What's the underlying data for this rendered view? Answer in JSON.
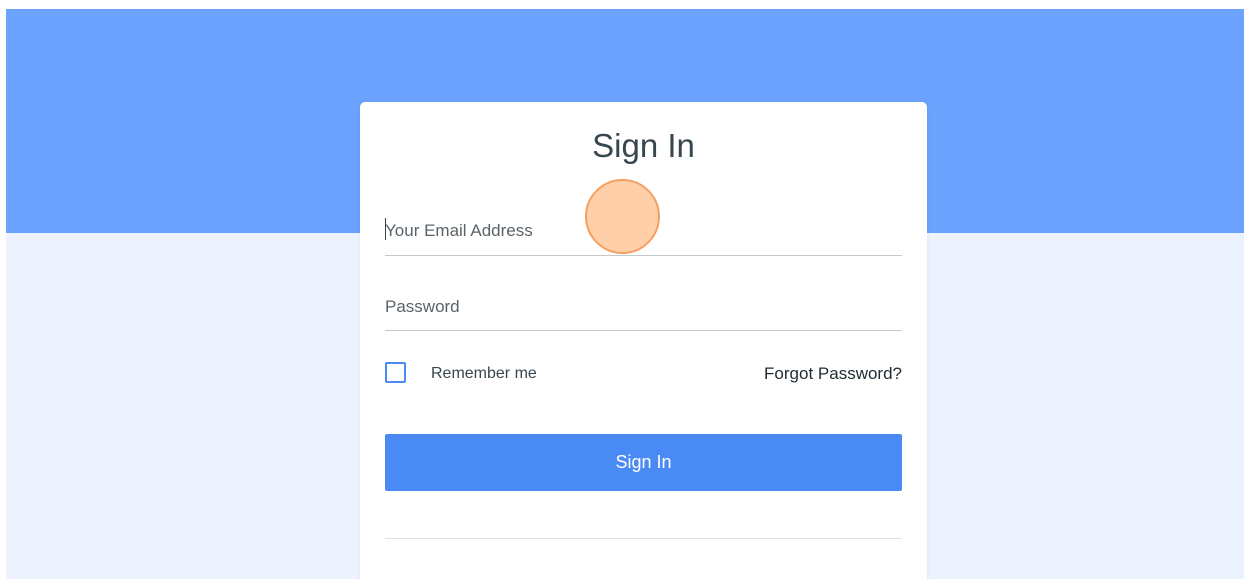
{
  "form": {
    "title": "Sign In",
    "email_placeholder": "Your Email Address",
    "email_value": "",
    "password_placeholder": "Password",
    "password_value": "",
    "remember_label": "Remember me",
    "remember_checked": false,
    "forgot_label": "Forgot Password?",
    "submit_label": "Sign In"
  },
  "colors": {
    "hero_background": "#6aa2fe",
    "page_background": "#ecf2fe",
    "accent": "#4a8af4",
    "title_text": "#37474f"
  }
}
